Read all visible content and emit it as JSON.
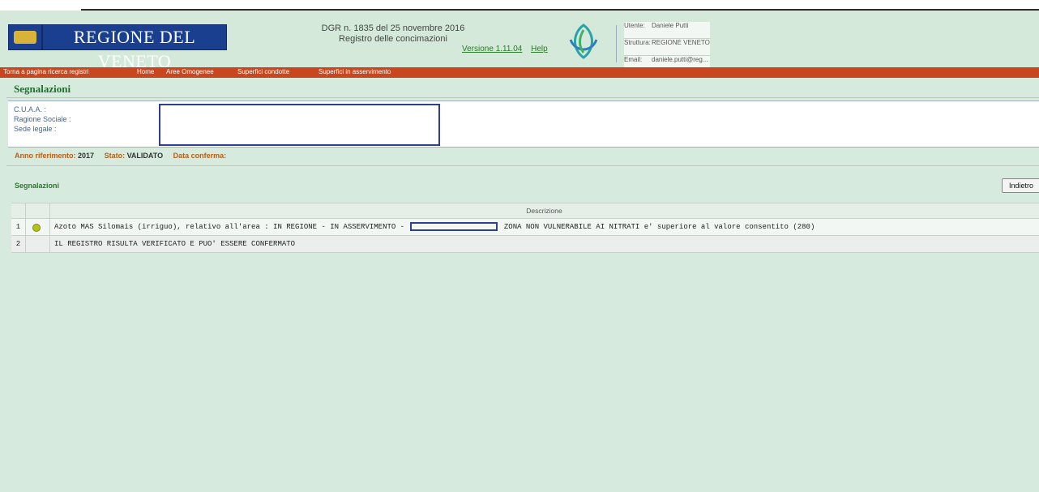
{
  "header": {
    "logo_text": "REGIONE DEL VENETO",
    "dgr_line1": "DGR n. 1835 del 25 novembre 2016",
    "dgr_line2": "Registro delle concimazioni",
    "version_link": "Versione 1.11.04",
    "help_link": "Help",
    "user": {
      "utente_label": "Utente:",
      "utente_value": "Daniele Putti",
      "struttura_label": "Struttura:",
      "struttura_value": "REGIONE VENETO",
      "email_label": "Email:",
      "email_value": "daniele.putti@reg..."
    }
  },
  "nav": [
    "Torna a pagina ricerca registri",
    "Home",
    "Aree Omogenee",
    "Superfici condotte",
    "Superfici in asservimento"
  ],
  "section_title": "Segnalazioni",
  "info": {
    "cuaa_label": "C.U.A.A. :",
    "ragione_label": "Ragione Sociale :",
    "sede_label": "Sede legale :"
  },
  "status": {
    "anno_label": "Anno riferimento:",
    "anno_value": "2017",
    "stato_label": "Stato:",
    "stato_value": "VALIDATO",
    "data_label": "Data conferma:",
    "data_value": ""
  },
  "segnalazioni_label": "Segnalazioni",
  "back_button": "Indietro",
  "table": {
    "header": "Descrizione",
    "rows": [
      {
        "n": "1",
        "icon": "warning-dot",
        "text_before": "Azoto MAS Silomais (irriguo), relativo all'area : IN REGIONE - IN ASSERVIMENTO -",
        "text_after": "ZONA NON VULNERABILE AI NITRATI e' superiore al valore consentito (280)"
      },
      {
        "n": "2",
        "icon": "",
        "text_before": "IL REGISTRO RISULTA VERIFICATO E PUO' ESSERE CONFERMATO",
        "text_after": ""
      }
    ]
  },
  "colors": {
    "page_bg": "#d6ebdd",
    "nav_bg": "#c8471e",
    "logo_bg": "#1b3f8f",
    "title_green": "#1f6e30",
    "status_label": "#b5611c",
    "redaction": "#2f3f8f"
  }
}
